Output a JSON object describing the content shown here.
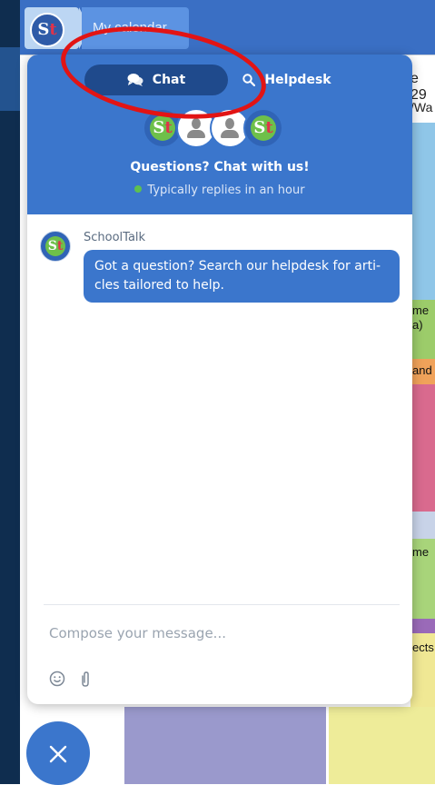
{
  "app": {
    "breadcrumb": "My calendar",
    "calendar_header_date": "e 29",
    "calendar_header_sub": "/Wa",
    "event_snippets": [
      "me",
      "a)",
      "and",
      "me",
      "ects"
    ]
  },
  "widget": {
    "tabs": [
      {
        "label": "Chat",
        "icon": "chat-bubbles-icon",
        "active": true
      },
      {
        "label": "Helpdesk",
        "icon": "search-icon",
        "active": false
      }
    ],
    "title": "Questions? Chat with us!",
    "status": "Typically replies in an hour",
    "message": {
      "sender": "SchoolTalk",
      "text": "Got a question? Search our helpdesk for arti-cles tailored to help."
    },
    "compose": {
      "placeholder": "Compose your message...",
      "tools": [
        "emoji-icon",
        "attachment-icon"
      ]
    }
  },
  "close_button": {
    "icon": "close-icon"
  },
  "colors": {
    "brand_blue": "#3b76cc",
    "active_tab": "#1f4a8c",
    "online_dot": "#5ec04f",
    "annotation_red": "#e21414"
  }
}
